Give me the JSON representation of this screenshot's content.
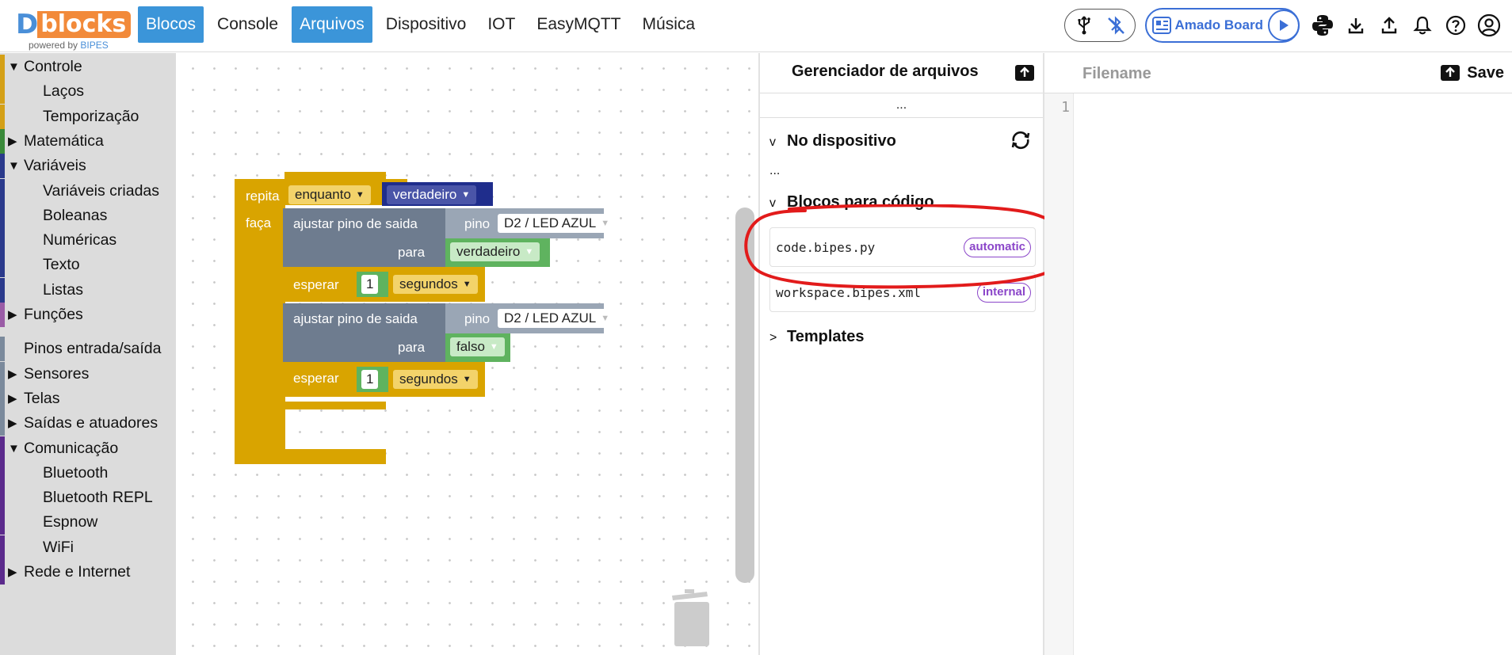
{
  "brand": {
    "logo_d": "D",
    "logo_rest": "blocks",
    "powered_prefix": "powered by",
    "powered_brand": "BIPES"
  },
  "nav": {
    "items": [
      {
        "label": "Blocos",
        "active": true
      },
      {
        "label": "Console",
        "active": false
      },
      {
        "label": "Arquivos",
        "active": true
      },
      {
        "label": "Dispositivo",
        "active": false
      },
      {
        "label": "IOT",
        "active": false
      },
      {
        "label": "EasyMQTT",
        "active": false
      },
      {
        "label": "Música",
        "active": false
      }
    ]
  },
  "toolbar": {
    "connection_icons": [
      "usb-icon",
      "bluetooth-off-icon"
    ],
    "board_name": "Amado Board",
    "icons": [
      "python-icon",
      "download-icon",
      "upload-icon",
      "bell-icon",
      "help-icon",
      "account-icon"
    ],
    "accent_color": "#3b6fd6"
  },
  "categories": [
    {
      "label": "Controle",
      "arrow": "▼",
      "sub": false,
      "color": "#d4a017"
    },
    {
      "label": "Laços",
      "arrow": "",
      "sub": true,
      "color": "#d4a017"
    },
    {
      "label": "Temporização",
      "arrow": "",
      "sub": true,
      "color": "#d4a017"
    },
    {
      "label": "Matemática",
      "arrow": "▶",
      "sub": false,
      "color": "#3a8a3a"
    },
    {
      "label": "Variáveis",
      "arrow": "▼",
      "sub": false,
      "color": "#2b3a8c"
    },
    {
      "label": "Variáveis criadas",
      "arrow": "",
      "sub": true,
      "color": "#2b3a8c"
    },
    {
      "label": "Boleanas",
      "arrow": "",
      "sub": true,
      "color": "#2b3a8c"
    },
    {
      "label": "Numéricas",
      "arrow": "",
      "sub": true,
      "color": "#2b3a8c"
    },
    {
      "label": "Texto",
      "arrow": "",
      "sub": true,
      "color": "#2b3a8c"
    },
    {
      "label": "Listas",
      "arrow": "",
      "sub": true,
      "color": "#2b3a8c"
    },
    {
      "label": "Funções",
      "arrow": "▶",
      "sub": false,
      "color": "#9a5ca6"
    },
    {
      "label": "Pinos entrada/saída",
      "arrow": "",
      "sub": false,
      "color": "#7b8a9c"
    },
    {
      "label": "Sensores",
      "arrow": "▶",
      "sub": false,
      "color": "#7b8a9c"
    },
    {
      "label": "Telas",
      "arrow": "▶",
      "sub": false,
      "color": "#7b8a9c"
    },
    {
      "label": "Saídas e atuadores",
      "arrow": "▶",
      "sub": false,
      "color": "#7b8a9c"
    },
    {
      "label": "Comunicação",
      "arrow": "▼",
      "sub": false,
      "color": "#5b2a8c"
    },
    {
      "label": "Bluetooth",
      "arrow": "",
      "sub": true,
      "color": "#5b2a8c"
    },
    {
      "label": "Bluetooth REPL",
      "arrow": "",
      "sub": true,
      "color": "#5b2a8c"
    },
    {
      "label": "Espnow",
      "arrow": "",
      "sub": true,
      "color": "#5b2a8c"
    },
    {
      "label": "WiFi",
      "arrow": "",
      "sub": true,
      "color": "#5b2a8c"
    },
    {
      "label": "Rede e Internet",
      "arrow": "▶",
      "sub": false,
      "color": "#5b2a8c"
    }
  ],
  "blocks": {
    "repeat": {
      "keyword": "repita",
      "mode": "enquanto",
      "condition": "verdadeiro",
      "do": "faça"
    },
    "set_pin_1": {
      "label": "ajustar pino de saida",
      "pin_label": "pino",
      "pin": "D2 / LED AZUL",
      "to_label": "para",
      "value": "verdadeiro"
    },
    "wait_1": {
      "label": "esperar",
      "amount": "1",
      "unit": "segundos"
    },
    "set_pin_2": {
      "label": "ajustar pino de saida",
      "pin_label": "pino",
      "pin": "D2 / LED AZUL",
      "to_label": "para",
      "value": "falso"
    },
    "wait_2": {
      "label": "esperar",
      "amount": "1",
      "unit": "segundos"
    }
  },
  "file_manager": {
    "title": "Gerenciador de arquivos",
    "path": "...",
    "on_device": {
      "label": "No dispositivo",
      "expanded_marker": "v",
      "content": "..."
    },
    "blocks_to_code": {
      "label": "Blocos para código",
      "expanded_marker": "v",
      "files": [
        {
          "name": "code.bipes.py",
          "badge": "automatic"
        },
        {
          "name": "workspace.bipes.xml",
          "badge": "internal"
        }
      ]
    },
    "templates": {
      "label": "Templates",
      "collapsed_marker": ">"
    }
  },
  "editor": {
    "filename_placeholder": "Filename",
    "filename_value": "",
    "save_label": "Save",
    "line_number": "1"
  }
}
